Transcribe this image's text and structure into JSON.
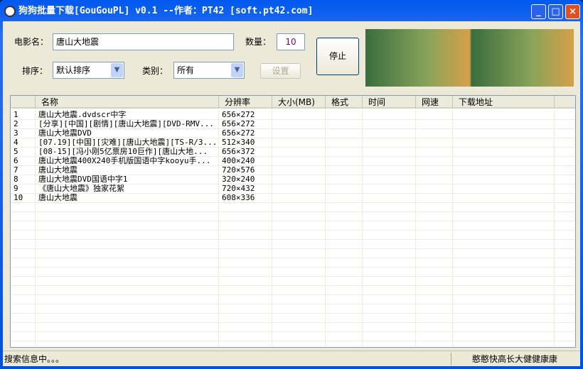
{
  "window": {
    "title": "狗狗批量下载[GouGouPL] v0.1 --作者：PT42 [soft.pt42.com]",
    "min": "_",
    "max": "□",
    "close": "×"
  },
  "form": {
    "movie_label": "电影名：",
    "movie_value": "唐山大地震",
    "count_label": "数量：",
    "count_value": "10",
    "sort_label": "排序：",
    "sort_value": "默认排序",
    "category_label": "类别：",
    "category_value": "所有",
    "settings_label": "设置",
    "stop_label": "停止"
  },
  "columns": [
    "",
    "名称",
    "分辨率",
    "大小(MB)",
    "格式",
    "时间",
    "网速",
    "下载地址"
  ],
  "rows": [
    [
      "1",
      "唐山大地震.dvdscr中字",
      "656×272"
    ],
    [
      "2",
      "[分享][中国][剧情][唐山大地震][DVD-RMV...",
      "656×272"
    ],
    [
      "3",
      "唐山大地震DVD",
      "656×272"
    ],
    [
      "4",
      "[07.19][中国][灾难][唐山大地震][TS-R/3...",
      "512×340"
    ],
    [
      "5",
      "[08-15][冯小刚5亿票房10巨作][唐山大地...",
      "656×372"
    ],
    [
      "6",
      "唐山大地震400X240手机版国语中字kooyu手...",
      "400×240"
    ],
    [
      "7",
      "唐山大地震",
      "720×576"
    ],
    [
      "8",
      "唐山大地震DVD国语中字1",
      "320×240"
    ],
    [
      "9",
      "《唐山大地震》独家花絮",
      "720×432"
    ],
    [
      "10",
      "唐山大地震",
      "608×336"
    ]
  ],
  "status": {
    "left": "搜索信息中。。。",
    "right": "憨憨快高长大健健康康"
  }
}
